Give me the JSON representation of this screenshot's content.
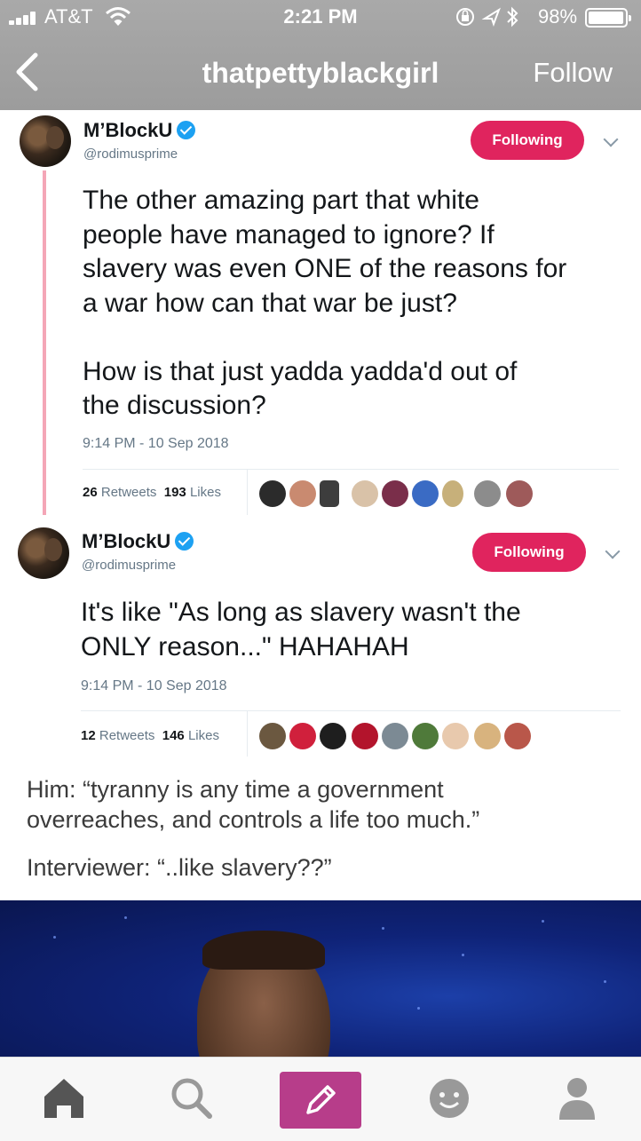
{
  "status_bar": {
    "carrier": "AT&T",
    "time": "2:21 PM",
    "battery": "98%",
    "icons": [
      "signal-bars-icon",
      "wifi-icon",
      "orientation-lock-icon",
      "location-arrow-icon",
      "bluetooth-icon",
      "battery-icon"
    ]
  },
  "nav": {
    "back_icon": "chevron-left-icon",
    "title": "thatpettyblackgirl",
    "follow_label": "Follow"
  },
  "tweets": [
    {
      "name": "M’BlockU",
      "handle": "@rodimusprime",
      "verified": true,
      "following_label": "Following",
      "text": "The other amazing part that white\npeople have managed to ignore? If\nslavery was even ONE of the reasons for\na war how can that war be just?\n\nHow is that just yadda yadda'd out of\nthe discussion?",
      "date": "9:14 PM - 10 Sep 2018",
      "retweets": "26",
      "retweets_label": "Retweets",
      "likes": "193",
      "likes_label": "Likes"
    },
    {
      "name": "M’BlockU",
      "handle": "@rodimusprime",
      "verified": true,
      "following_label": "Following",
      "text": "It's like \"As long as slavery wasn't the\nONLY reason...\" HAHAHAH",
      "date": "9:14 PM - 10 Sep 2018",
      "retweets": "12",
      "retweets_label": "Retweets",
      "likes": "146",
      "likes_label": "Likes"
    }
  ],
  "caption": {
    "line1": "Him: “tyranny is any time a government\noverreaches, and controls a life too much.”",
    "line2": "Interviewer: “..like slavery??”"
  },
  "tab_bar": {
    "tabs": [
      "home-icon",
      "search-icon",
      "compose-icon",
      "activity-icon",
      "account-icon"
    ],
    "accent": "#b73d8a"
  },
  "colors": {
    "following_button": "#e0245e",
    "verified_badge": "#1da1f2",
    "thread_line": "#f4a6b7"
  }
}
